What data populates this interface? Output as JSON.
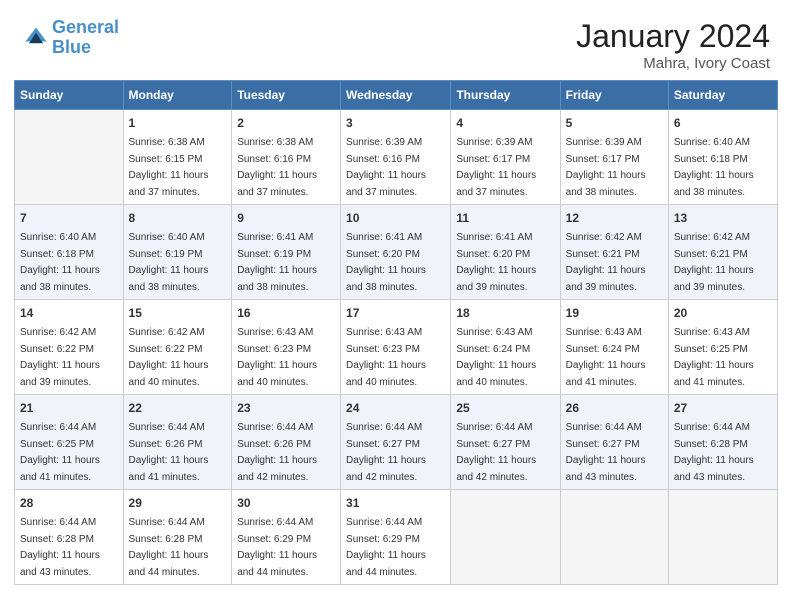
{
  "header": {
    "logo_line1": "General",
    "logo_line2": "Blue",
    "month": "January 2024",
    "location": "Mahra, Ivory Coast"
  },
  "days_of_week": [
    "Sunday",
    "Monday",
    "Tuesday",
    "Wednesday",
    "Thursday",
    "Friday",
    "Saturday"
  ],
  "weeks": [
    [
      {
        "day": "",
        "empty": true
      },
      {
        "day": "1",
        "sunrise": "6:38 AM",
        "sunset": "6:15 PM",
        "daylight": "11 hours and 37 minutes."
      },
      {
        "day": "2",
        "sunrise": "6:38 AM",
        "sunset": "6:16 PM",
        "daylight": "11 hours and 37 minutes."
      },
      {
        "day": "3",
        "sunrise": "6:39 AM",
        "sunset": "6:16 PM",
        "daylight": "11 hours and 37 minutes."
      },
      {
        "day": "4",
        "sunrise": "6:39 AM",
        "sunset": "6:17 PM",
        "daylight": "11 hours and 37 minutes."
      },
      {
        "day": "5",
        "sunrise": "6:39 AM",
        "sunset": "6:17 PM",
        "daylight": "11 hours and 38 minutes."
      },
      {
        "day": "6",
        "sunrise": "6:40 AM",
        "sunset": "6:18 PM",
        "daylight": "11 hours and 38 minutes."
      }
    ],
    [
      {
        "day": "7",
        "sunrise": "6:40 AM",
        "sunset": "6:18 PM",
        "daylight": "11 hours and 38 minutes."
      },
      {
        "day": "8",
        "sunrise": "6:40 AM",
        "sunset": "6:19 PM",
        "daylight": "11 hours and 38 minutes."
      },
      {
        "day": "9",
        "sunrise": "6:41 AM",
        "sunset": "6:19 PM",
        "daylight": "11 hours and 38 minutes."
      },
      {
        "day": "10",
        "sunrise": "6:41 AM",
        "sunset": "6:20 PM",
        "daylight": "11 hours and 38 minutes."
      },
      {
        "day": "11",
        "sunrise": "6:41 AM",
        "sunset": "6:20 PM",
        "daylight": "11 hours and 39 minutes."
      },
      {
        "day": "12",
        "sunrise": "6:42 AM",
        "sunset": "6:21 PM",
        "daylight": "11 hours and 39 minutes."
      },
      {
        "day": "13",
        "sunrise": "6:42 AM",
        "sunset": "6:21 PM",
        "daylight": "11 hours and 39 minutes."
      }
    ],
    [
      {
        "day": "14",
        "sunrise": "6:42 AM",
        "sunset": "6:22 PM",
        "daylight": "11 hours and 39 minutes."
      },
      {
        "day": "15",
        "sunrise": "6:42 AM",
        "sunset": "6:22 PM",
        "daylight": "11 hours and 40 minutes."
      },
      {
        "day": "16",
        "sunrise": "6:43 AM",
        "sunset": "6:23 PM",
        "daylight": "11 hours and 40 minutes."
      },
      {
        "day": "17",
        "sunrise": "6:43 AM",
        "sunset": "6:23 PM",
        "daylight": "11 hours and 40 minutes."
      },
      {
        "day": "18",
        "sunrise": "6:43 AM",
        "sunset": "6:24 PM",
        "daylight": "11 hours and 40 minutes."
      },
      {
        "day": "19",
        "sunrise": "6:43 AM",
        "sunset": "6:24 PM",
        "daylight": "11 hours and 41 minutes."
      },
      {
        "day": "20",
        "sunrise": "6:43 AM",
        "sunset": "6:25 PM",
        "daylight": "11 hours and 41 minutes."
      }
    ],
    [
      {
        "day": "21",
        "sunrise": "6:44 AM",
        "sunset": "6:25 PM",
        "daylight": "11 hours and 41 minutes."
      },
      {
        "day": "22",
        "sunrise": "6:44 AM",
        "sunset": "6:26 PM",
        "daylight": "11 hours and 41 minutes."
      },
      {
        "day": "23",
        "sunrise": "6:44 AM",
        "sunset": "6:26 PM",
        "daylight": "11 hours and 42 minutes."
      },
      {
        "day": "24",
        "sunrise": "6:44 AM",
        "sunset": "6:27 PM",
        "daylight": "11 hours and 42 minutes."
      },
      {
        "day": "25",
        "sunrise": "6:44 AM",
        "sunset": "6:27 PM",
        "daylight": "11 hours and 42 minutes."
      },
      {
        "day": "26",
        "sunrise": "6:44 AM",
        "sunset": "6:27 PM",
        "daylight": "11 hours and 43 minutes."
      },
      {
        "day": "27",
        "sunrise": "6:44 AM",
        "sunset": "6:28 PM",
        "daylight": "11 hours and 43 minutes."
      }
    ],
    [
      {
        "day": "28",
        "sunrise": "6:44 AM",
        "sunset": "6:28 PM",
        "daylight": "11 hours and 43 minutes."
      },
      {
        "day": "29",
        "sunrise": "6:44 AM",
        "sunset": "6:28 PM",
        "daylight": "11 hours and 44 minutes."
      },
      {
        "day": "30",
        "sunrise": "6:44 AM",
        "sunset": "6:29 PM",
        "daylight": "11 hours and 44 minutes."
      },
      {
        "day": "31",
        "sunrise": "6:44 AM",
        "sunset": "6:29 PM",
        "daylight": "11 hours and 44 minutes."
      },
      {
        "day": "",
        "empty": true
      },
      {
        "day": "",
        "empty": true
      },
      {
        "day": "",
        "empty": true
      }
    ]
  ]
}
